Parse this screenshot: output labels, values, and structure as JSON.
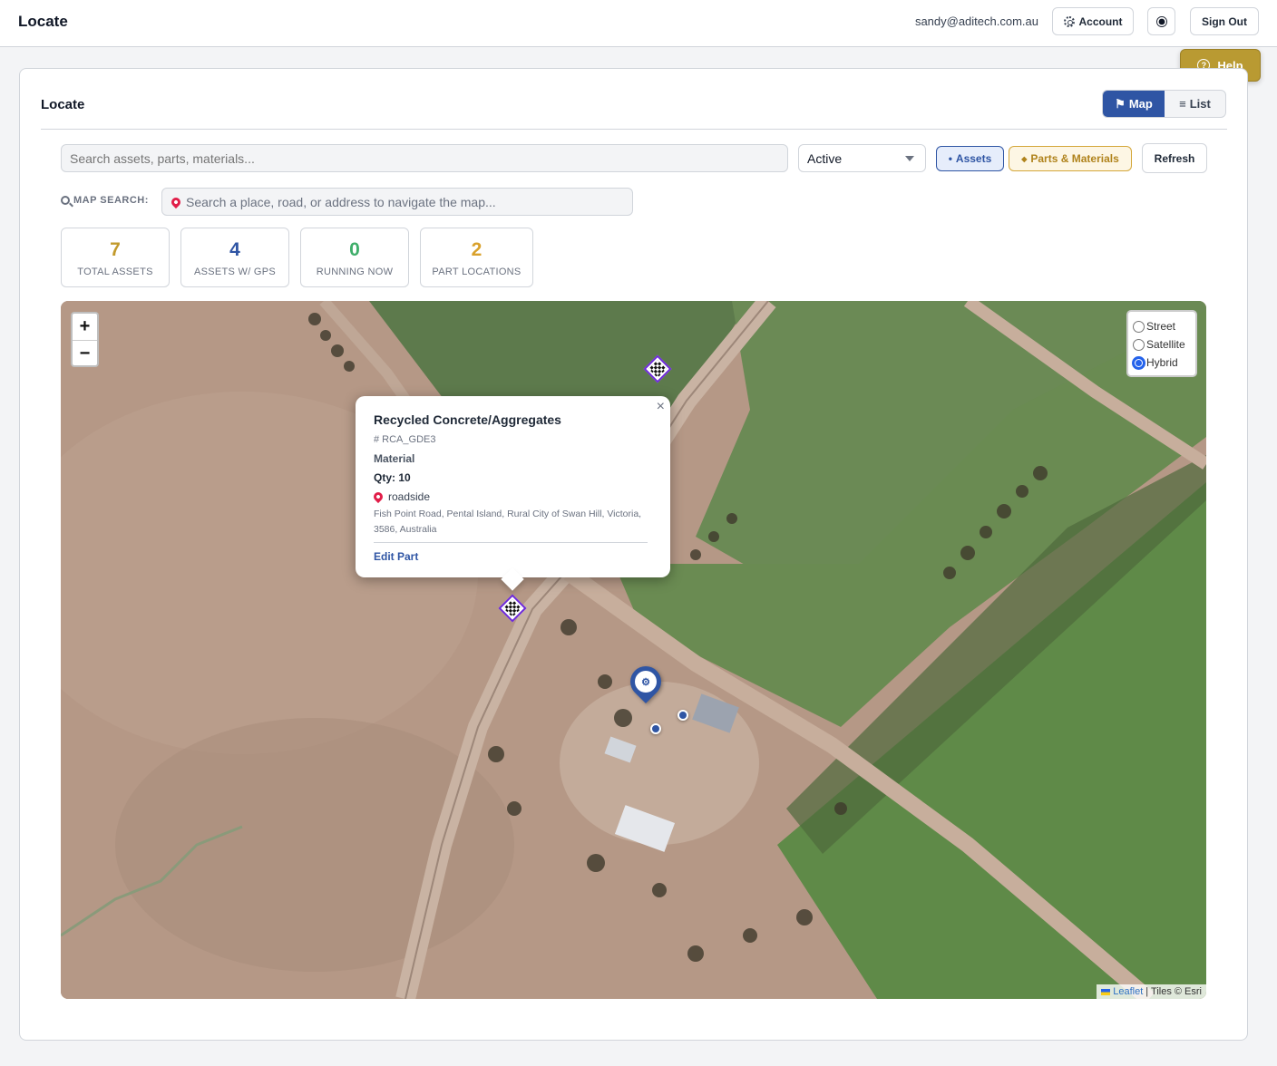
{
  "header": {
    "app_title": "Locate",
    "user_email": "sandy@aditech.com.au",
    "account_label": "Account",
    "sign_out_label": "Sign Out"
  },
  "help": {
    "label": "Help"
  },
  "card": {
    "title": "Locate",
    "view_toggle": {
      "map_label": "Map",
      "list_label": "List",
      "active": "Map"
    }
  },
  "filters": {
    "search_placeholder": "Search assets, parts, materials...",
    "status_value": "Active",
    "assets_chip": "Assets",
    "parts_chip": "Parts & Materials",
    "refresh_label": "Refresh"
  },
  "map_search": {
    "label": "MAP SEARCH:",
    "placeholder": "Search a place, road, or address to navigate the map..."
  },
  "stats": [
    {
      "value": "7",
      "label": "TOTAL ASSETS",
      "color": "#c29a2c"
    },
    {
      "value": "4",
      "label": "ASSETS W/ GPS",
      "color": "#2f55a4"
    },
    {
      "value": "0",
      "label": "RUNNING NOW",
      "color": "#3fae6a"
    },
    {
      "value": "2",
      "label": "PART LOCATIONS",
      "color": "#d9a12b"
    }
  ],
  "map": {
    "zoom_in": "+",
    "zoom_out": "−",
    "layers": [
      {
        "label": "Street",
        "selected": false
      },
      {
        "label": "Satellite",
        "selected": false
      },
      {
        "label": "Hybrid",
        "selected": true
      }
    ],
    "attribution_link": "Leaflet",
    "attribution_text": "| Tiles © Esri"
  },
  "popup": {
    "title": "Recycled Concrete/Aggregates",
    "code": "# RCA_GDE3",
    "type": "Material",
    "qty": "Qty: 10",
    "location": "roadside",
    "address": "Fish Point Road, Pental Island, Rural City of Swan Hill, Victoria, 3586, Australia",
    "edit_label": "Edit Part",
    "close": "×"
  },
  "colors": {
    "primary": "#2f55a4",
    "help_gold": "#b99a32",
    "parts_amber": "#d4a73a"
  }
}
